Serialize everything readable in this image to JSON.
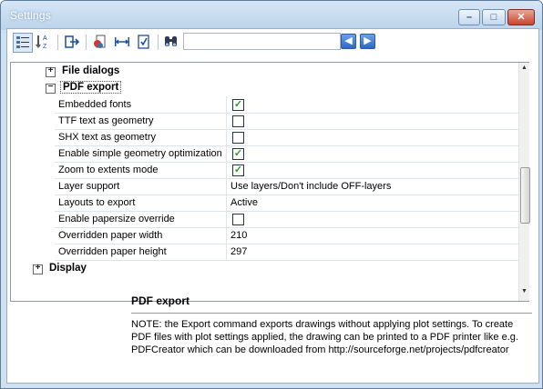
{
  "window": {
    "title": "Settings"
  },
  "toolbar": {
    "buttons": [
      "categorized-icon",
      "alphabetical-icon",
      "export-icon",
      "import-icon",
      "width-icon",
      "validate-icon",
      "find-icon"
    ],
    "search_value": "",
    "nav": {
      "prev": "◀",
      "next": "▶"
    }
  },
  "grid": {
    "categories": [
      {
        "label": "File dialogs",
        "expander": "+",
        "expanded": false
      },
      {
        "label": "PDF export",
        "expander": "−",
        "expanded": true,
        "selected": true
      },
      {
        "label": "Display",
        "expander": "+",
        "expanded": false
      }
    ],
    "properties": [
      {
        "name": "Embedded fonts",
        "type": "checkbox",
        "checked": true
      },
      {
        "name": "TTF text as geometry",
        "type": "checkbox",
        "checked": false
      },
      {
        "name": "SHX text as geometry",
        "type": "checkbox",
        "checked": false
      },
      {
        "name": "Enable simple geometry optimization",
        "type": "checkbox",
        "checked": true
      },
      {
        "name": "Zoom to extents mode",
        "type": "checkbox",
        "checked": true
      },
      {
        "name": "Layer support",
        "type": "text",
        "value": "Use layers/Don't include OFF-layers"
      },
      {
        "name": "Layouts to export",
        "type": "text",
        "value": "Active"
      },
      {
        "name": "Enable papersize override",
        "type": "checkbox",
        "checked": false
      },
      {
        "name": "Overridden paper width",
        "type": "text",
        "value": "210"
      },
      {
        "name": "Overridden paper height",
        "type": "text",
        "value": "297"
      }
    ],
    "check_glyph": "✓"
  },
  "description": {
    "title": "PDF export",
    "lines": [
      "NOTE: the Export command exports drawings without applying plot settings. To create",
      "PDF files with plot settings applied, the drawing can be printed to a PDF printer like e.g.",
      "PDFCreator which can be downloaded from http://sourceforge.net/projects/pdfcreator"
    ]
  },
  "colors": {
    "title_text": "#ffffff",
    "check": "#2b9b2b",
    "accent": "#2f68c4"
  }
}
